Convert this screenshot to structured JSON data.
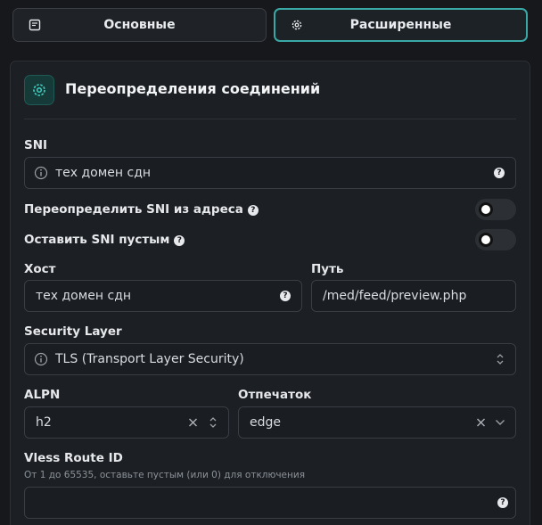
{
  "tabs": {
    "basic": {
      "label": "Основные",
      "icon": "note-icon"
    },
    "advanced": {
      "label": "Расширенные",
      "icon": "gear-icon",
      "active": true
    }
  },
  "section": {
    "title": "Переопределения соединений",
    "icon": "gear-icon"
  },
  "sni": {
    "label": "SNI",
    "value": "тех домен сдн"
  },
  "override_sni": {
    "label": "Переопределить SNI из адреса",
    "enabled": false
  },
  "empty_sni": {
    "label": "Оставить SNI пустым",
    "enabled": false
  },
  "host": {
    "label": "Хост",
    "value": "тех домен сдн"
  },
  "path": {
    "label": "Путь",
    "value": "/med/feed/preview.php"
  },
  "security_layer": {
    "label": "Security Layer",
    "value": "TLS (Transport Layer Security)"
  },
  "alpn": {
    "label": "ALPN",
    "value": "h2"
  },
  "fingerprint": {
    "label": "Отпечаток",
    "value": "edge"
  },
  "vless_route": {
    "label": "Vless Route ID",
    "hint": "От 1 до 65535, оставьте пустым (или 0) для отключения",
    "value": ""
  },
  "help_glyph": "?",
  "colors": {
    "accent": "#3aa9a6",
    "background": "#16181c",
    "card": "#1c1f23"
  }
}
